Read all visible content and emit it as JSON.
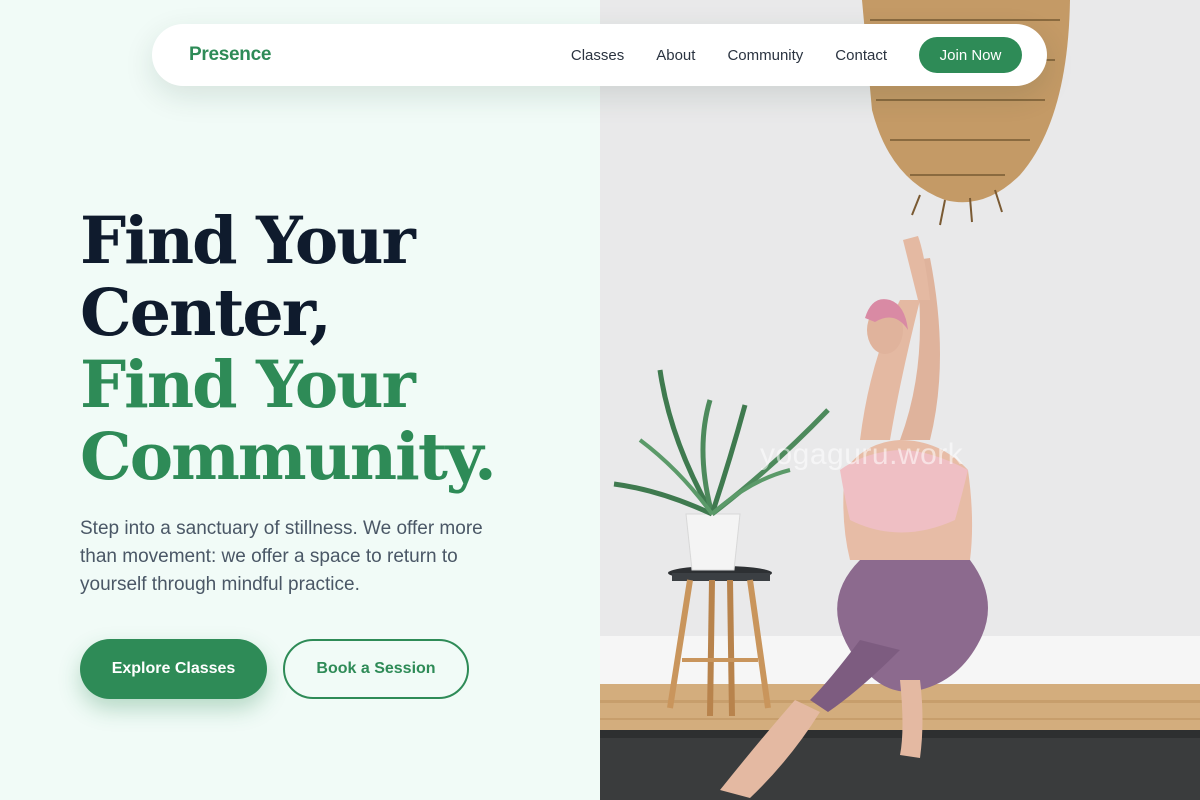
{
  "nav": {
    "brand": "Presence",
    "links": [
      "Classes",
      "About",
      "Community",
      "Contact"
    ],
    "cta": "Join Now"
  },
  "hero": {
    "headline_lines": [
      "Find Your",
      "Center,",
      "Find Your",
      "Community."
    ],
    "subtext": "Step into a sanctuary of stillness. We offer more than movement: we offer a space to return to yourself through mindful practice.",
    "primary_button": "Explore Classes",
    "secondary_button": "Book a Session"
  },
  "image": {
    "watermark": "yogaguru.work"
  },
  "colors": {
    "accent": "#2e8b57",
    "headline_dark": "#0f1b2d",
    "background": "#f1fbf7"
  }
}
